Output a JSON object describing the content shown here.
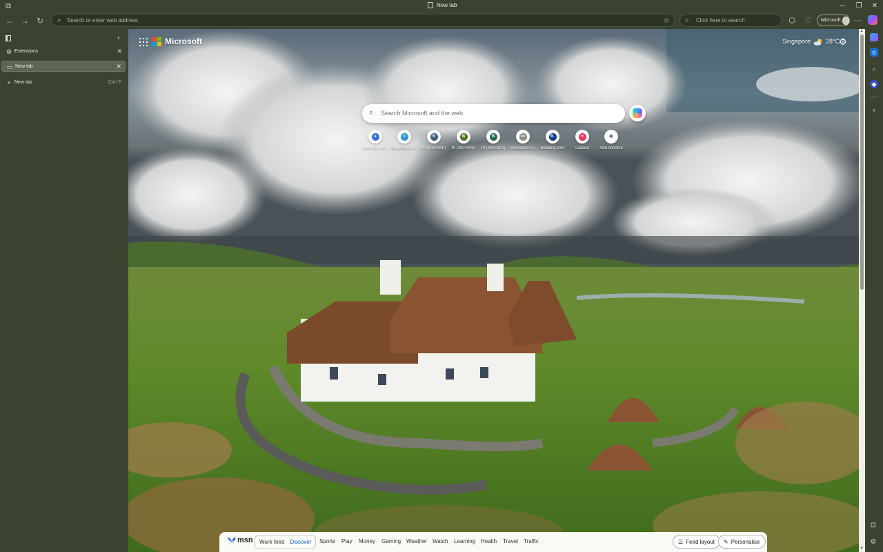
{
  "window": {
    "tab_title": "New tab"
  },
  "toolbar": {
    "address_placeholder": "Search or enter web address",
    "search_placeholder": "Click here to search",
    "profile_name": "Microsoft"
  },
  "vertical_tabs": {
    "items": [
      {
        "label": "Extensions",
        "active": false
      },
      {
        "label": "New tab",
        "active": true
      }
    ],
    "new_tab_label": "New tab",
    "new_tab_shortcut": "Ctrl+T"
  },
  "ntp": {
    "brand": "Microsoft",
    "weather": {
      "city": "Singapore",
      "temp": "28°C"
    },
    "search_placeholder": "Search Microsoft and the web",
    "shortcuts": [
      {
        "label": "prod.ohrc.pt...",
        "icon": "blue-orb-icon",
        "color": "#3b6fd8",
        "glyph": "●"
      },
      {
        "label": "SuperAlign s...",
        "icon": "superalign-icon",
        "color": "#2a9bd6",
        "glyph": "✕"
      },
      {
        "label": "th (300×300)",
        "icon": "letter-b-icon",
        "color": "#3c5a7a",
        "glyph": "B"
      },
      {
        "label": "th (300×300)",
        "icon": "letter-b-icon",
        "color": "#4a7a1e",
        "glyph": "B"
      },
      {
        "label": "th (300×300)",
        "icon": "letter-b-icon",
        "color": "#1f6b4a",
        "glyph": "B"
      },
      {
        "label": "cosmos08 A...",
        "icon": "dots-icon",
        "color": "#8a8a8a",
        "glyph": "•••"
      },
      {
        "label": "Booking.com",
        "icon": "booking-icon",
        "color": "#0b3a8a",
        "glyph": "B."
      },
      {
        "label": "Lazada",
        "icon": "lazada-heart-icon",
        "color": "#f0365c",
        "glyph": "♥"
      },
      {
        "label": "Add shortcut",
        "icon": "plus-icon",
        "color": "#ffffff",
        "glyph": "+"
      }
    ]
  },
  "msn": {
    "logo_text": "msn",
    "feed_tabs": [
      {
        "label": "Work feed",
        "active": false
      },
      {
        "label": "Discover",
        "active": true
      }
    ],
    "categories": [
      "Sports",
      "Play",
      "Money",
      "Gaming",
      "Weather",
      "Watch",
      "Learning",
      "Health",
      "Travel",
      "Traffic"
    ],
    "feed_layout_label": "Feed layout",
    "personalise_label": "Personalise"
  }
}
